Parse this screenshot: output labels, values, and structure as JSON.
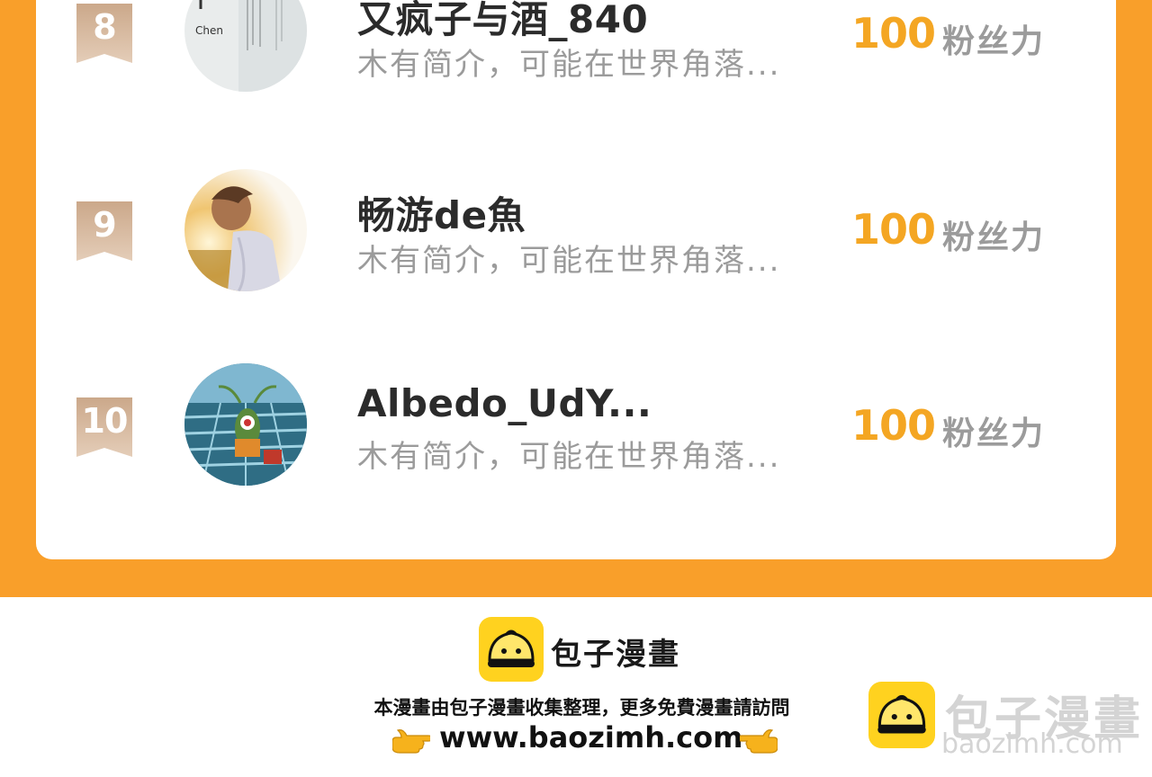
{
  "colors": {
    "frame_orange": "#F99F2A",
    "fan_value": "#F4A623",
    "badge": "#D8BBA0",
    "card": "#FFFFFF"
  },
  "rankings": [
    {
      "rank": "8",
      "name": "又疯子与酒_840",
      "bio": "木有简介，可能在世界角落...",
      "fan_value": "100",
      "fan_unit": "粉丝力",
      "avatar": "calligraphy-avatar"
    },
    {
      "rank": "9",
      "name": "畅游de魚",
      "bio": "木有简介，可能在世界角落...",
      "fan_value": "100",
      "fan_unit": "粉丝力",
      "avatar": "boy-sunset-avatar"
    },
    {
      "rank": "10",
      "name": "Albedo_UdY...",
      "bio": "木有简介，可能在世界角落...",
      "fan_value": "100",
      "fan_unit": "粉丝力",
      "avatar": "plankton-cartoon-avatar"
    }
  ],
  "watermark": {
    "brand": "包子漫畫",
    "tagline": "本漫畫由包子漫畫收集整理，更多免費漫畫請訪問",
    "url": "www.baozimh.com",
    "corner_brand": "包子漫畫",
    "corner_url": "baozimh.com",
    "logo_icon": "bun-logo-icon",
    "pointer_icon": "pointing-hand-icon"
  }
}
